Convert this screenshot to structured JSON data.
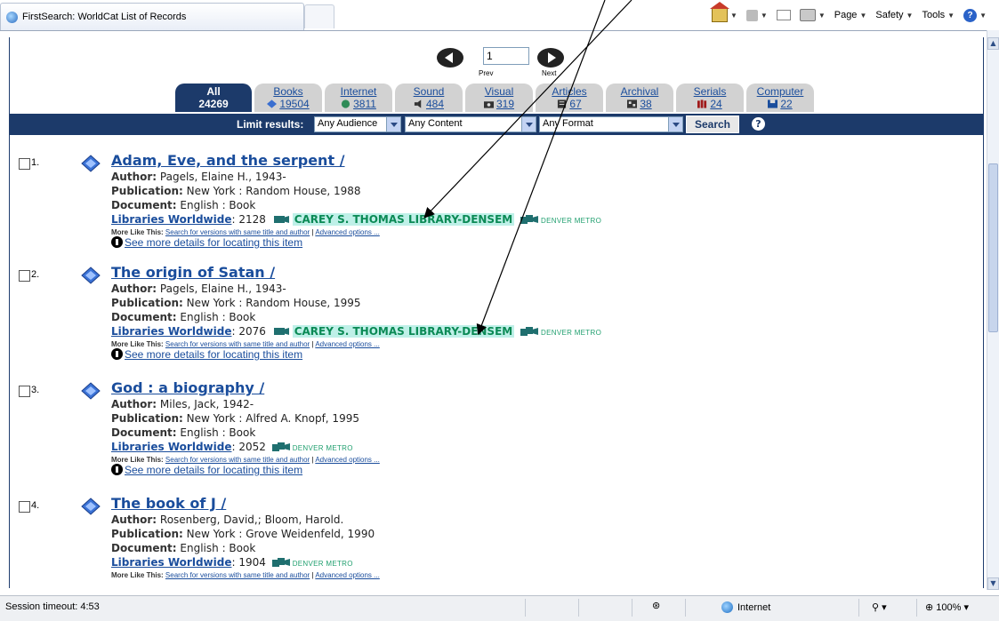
{
  "browser": {
    "tab_title": "FirstSearch: WorldCat List of Records",
    "commands": {
      "page": "Page",
      "safety": "Safety",
      "tools": "Tools"
    }
  },
  "pager": {
    "page_value": "1",
    "prev_label": "Prev",
    "next_label": "Next"
  },
  "tabs": [
    {
      "label": "All",
      "count": "24269",
      "icon": "none",
      "active": true
    },
    {
      "label": "Books",
      "count": "19504",
      "icon": "book-icon",
      "active": false
    },
    {
      "label": "Internet",
      "count": "3811",
      "icon": "internet-icon",
      "active": false
    },
    {
      "label": "Sound",
      "count": "484",
      "icon": "sound-icon",
      "active": false
    },
    {
      "label": "Visual",
      "count": "319",
      "icon": "visual-icon",
      "active": false
    },
    {
      "label": "Articles",
      "count": "67",
      "icon": "articles-icon",
      "active": false
    },
    {
      "label": "Archival",
      "count": "38",
      "icon": "archival-icon",
      "active": false
    },
    {
      "label": "Serials",
      "count": "24",
      "icon": "serials-icon",
      "active": false
    },
    {
      "label": "Computer",
      "count": "22",
      "icon": "computer-icon",
      "active": false
    }
  ],
  "limit": {
    "label": "Limit results:",
    "audience": "Any Audience",
    "content": "Any Content",
    "format": "Any Format",
    "search_label": "Search",
    "help": "?"
  },
  "labels": {
    "author": "Author:",
    "publication": "Publication:",
    "document": "Document:",
    "libraries": "Libraries Worldwide",
    "more_like": "More Like This:",
    "search_versions": "Search for versions with same title and author",
    "pipe": "|",
    "advanced": "Advanced options ...",
    "see_more": "See more details for locating this item",
    "carey": "CAREY S. THOMAS LIBRARY-DENSEM",
    "denver": "DENVER METRO"
  },
  "records": [
    {
      "num": "1.",
      "title": "Adam, Eve, and the serpent /",
      "author": "Pagels, Elaine H., 1943-",
      "publication": "New York : Random House, 1988",
      "document": "English : Book",
      "libraries": ": 2128",
      "has_carey": true
    },
    {
      "num": "2.",
      "title": "The origin of Satan /",
      "author": "Pagels, Elaine H., 1943-",
      "publication": "New York : Random House, 1995",
      "document": "English : Book",
      "libraries": ": 2076",
      "has_carey": true
    },
    {
      "num": "3.",
      "title": "God : a biography /",
      "author": "Miles, Jack, 1942-",
      "publication": "New York : Alfred A. Knopf, 1995",
      "document": "English : Book",
      "libraries": ": 2052",
      "has_carey": false
    },
    {
      "num": "4.",
      "title": "The book of J /",
      "author": "Rosenberg, David,; Bloom, Harold.",
      "publication": "New York : Grove Weidenfeld, 1990",
      "document": "English : Book",
      "libraries": ": 1904",
      "has_carey": false
    }
  ],
  "status": {
    "timeout": "Session timeout: 4:53",
    "zone": "Internet",
    "zoom": "100%"
  }
}
